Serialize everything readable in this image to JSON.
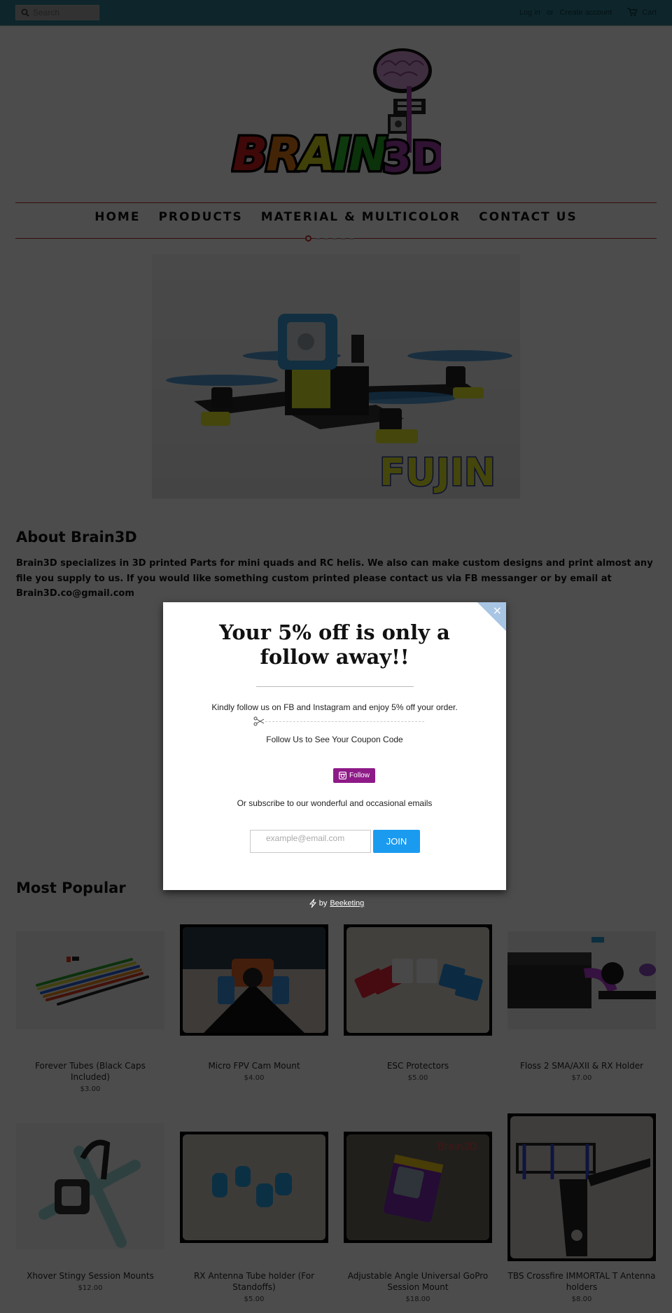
{
  "header": {
    "search_placeholder": "Search",
    "login_label": "Log in",
    "or_label": "or",
    "create_account_label": "Create account",
    "cart_label": "Cart"
  },
  "brand": {
    "logo_text_main": "BRAIN",
    "logo_text_suffix": "3D"
  },
  "nav": {
    "items": [
      {
        "label": "HOME"
      },
      {
        "label": "PRODUCTS"
      },
      {
        "label": "MATERIAL & MULTICOLOR"
      },
      {
        "label": "CONTACT US"
      }
    ],
    "slide_count": 6,
    "active_slide": 1
  },
  "hero": {
    "caption": "Fujin"
  },
  "about": {
    "title": "About Brain3D",
    "text": "Brain3D specializes in 3D printed Parts for mini quads and RC helis. We also can make custom designs and print almost any file you supply to us. If you would like something custom printed please contact us via FB messanger or by email at Brain3D.co@gmail.com"
  },
  "popular": {
    "title": "Most Popular",
    "products": [
      {
        "title": "Forever Tubes (Black Caps Included)",
        "price": "$3.00"
      },
      {
        "title": "Micro FPV Cam Mount",
        "price": "$4.00"
      },
      {
        "title": "ESC Protectors",
        "price": "$5.00"
      },
      {
        "title": "Floss 2 SMA/AXII & RX Holder",
        "price": "$7.00"
      },
      {
        "title": "Xhover Stingy Session Mounts",
        "price": "$12.00"
      },
      {
        "title": "RX Antenna Tube holder (For Standoffs)",
        "price": "$5.00"
      },
      {
        "title": "Adjustable Angle Universal GoPro Session Mount",
        "price": "$18.00"
      },
      {
        "title": "TBS Crossfire IMMORTAL T Antenna holders",
        "price": "$8.00"
      }
    ]
  },
  "popup": {
    "close_icon": "×",
    "title": "Your 5% off is only a follow away!!",
    "subtitle": "Kindly follow us on FB and Instagram and enjoy 5% off your order.",
    "follow_label": "Follow Us to See Your Coupon Code",
    "instagram_button_label": "Follow",
    "subscribe_label": "Or subscribe to our wonderful and occasional emails",
    "email_placeholder": "example@email.com",
    "email_value": "",
    "join_label": "JOIN"
  },
  "powered_by": {
    "by_label": "by",
    "vendor_label": "Beeketing"
  },
  "colors": {
    "topbar": "#2f7f90",
    "nav_line": "#b72c2c",
    "instagram": "#8e1a87",
    "join_button": "#1a9bf0",
    "close_corner": "#a8c5e4"
  }
}
